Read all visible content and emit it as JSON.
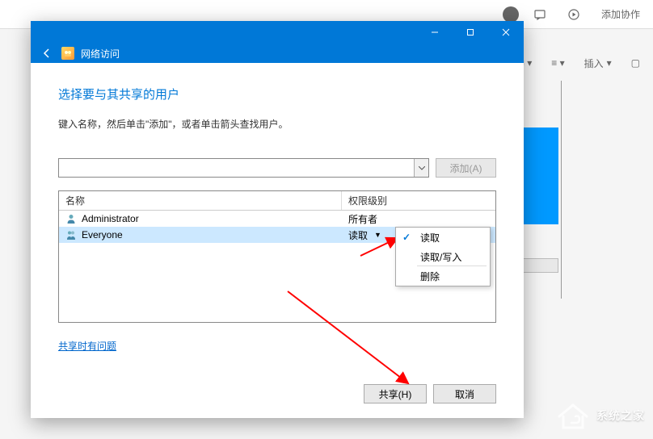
{
  "bg": {
    "add_collab": "添加协作",
    "insert": "插入",
    "toolbar_icons": {
      "bullet": "≡",
      "numbered": "≡",
      "box": "▢"
    }
  },
  "dialog": {
    "title": "网络访问",
    "heading": "选择要与其共享的用户",
    "subtext": "键入名称，然后单击\"添加\"，或者单击箭头查找用户。",
    "add_button": "添加(A)",
    "columns": {
      "name": "名称",
      "perm": "权限级别"
    },
    "rows": [
      {
        "name": "Administrator",
        "perm": "所有者",
        "selected": false
      },
      {
        "name": "Everyone",
        "perm": "读取",
        "selected": true,
        "dropdown": true
      }
    ],
    "menu": [
      {
        "label": "读取",
        "checked": true,
        "sep": false
      },
      {
        "label": "读取/写入",
        "checked": false,
        "sep": true
      },
      {
        "label": "删除",
        "checked": false,
        "sep": false
      }
    ],
    "help_link": "共享时有问题",
    "buttons": {
      "share": "共享(H)",
      "cancel": "取消"
    }
  },
  "watermark": "系统之家"
}
